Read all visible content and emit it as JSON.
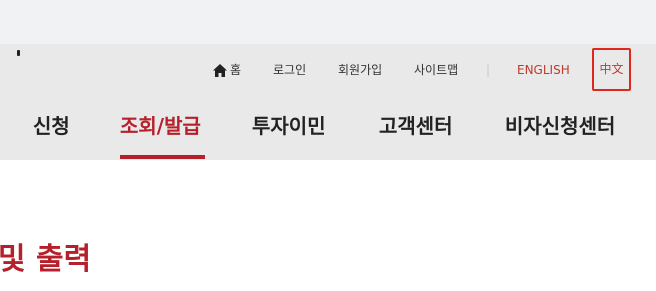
{
  "utility_nav": {
    "home": "홈",
    "login": "로그인",
    "join": "회원가입",
    "sitemap": "사이트맵",
    "divider": "|",
    "english": "ENGLISH",
    "chinese": "中文",
    "home_icon": "home-icon"
  },
  "main_nav": {
    "items": [
      "신청",
      "조회/발급",
      "투자이민",
      "고객센터",
      "비자신청센터"
    ],
    "active_index": 1
  },
  "page": {
    "title": "및 출력"
  },
  "colors": {
    "accent": "#b5202a",
    "highlight_box": "#e3261c",
    "header_bg": "#e9e9e9",
    "top_strip_bg": "#f1f2f4"
  }
}
